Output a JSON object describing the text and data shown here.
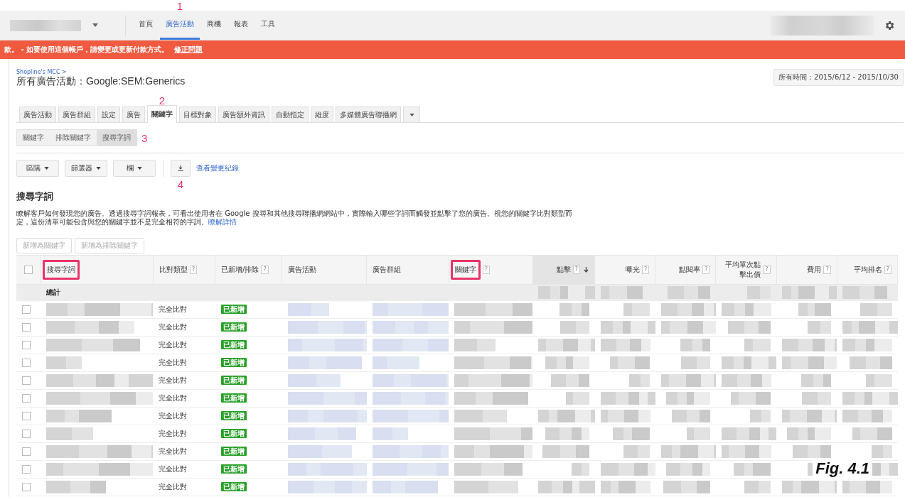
{
  "nav": {
    "items": [
      {
        "label": "首頁",
        "selected": false
      },
      {
        "label": "廣告活動",
        "selected": true,
        "marker": "1"
      },
      {
        "label": "商機",
        "selected": false
      },
      {
        "label": "報表",
        "selected": false
      },
      {
        "label": "工具",
        "selected": false
      }
    ]
  },
  "alert": {
    "message": "款。 - 如要使用這個帳戶，請變更或更新付款方式。",
    "link": "修正問題"
  },
  "breadcrumb": "Shopline's MCC >",
  "title": "所有廣告活動：Google:SEM:Generics",
  "date_range": "所有時間：2015/6/12 - 2015/10/30",
  "tabs": [
    {
      "label": "廣告活動",
      "selected": false
    },
    {
      "label": "廣告群組",
      "selected": false
    },
    {
      "label": "設定",
      "selected": false
    },
    {
      "label": "廣告",
      "selected": false
    },
    {
      "label": "關鍵字",
      "selected": true,
      "marker": "2"
    },
    {
      "label": "目標對象",
      "selected": false
    },
    {
      "label": "廣告額外資訊",
      "selected": false
    },
    {
      "label": "自動指定",
      "selected": false
    },
    {
      "label": "維度",
      "selected": false
    },
    {
      "label": "多媒體廣告聯播網",
      "selected": false
    }
  ],
  "subtabs": [
    {
      "label": "關鍵字",
      "selected": false
    },
    {
      "label": "排除關鍵字",
      "selected": false
    },
    {
      "label": "搜尋字詞",
      "selected": true,
      "marker": "3"
    }
  ],
  "toolbar": {
    "dropdowns": [
      "區隔",
      "篩選器",
      "欄"
    ],
    "download_marker": "4",
    "link": "查看變更紀錄"
  },
  "heading": "搜尋字詞",
  "description": "瞭解客戶如何發現您的廣告。透過搜尋字詞報表，可看出使用者在 Google 搜尋和其他搜尋聯播網網站中，實際輸入哪些字詞而觸發並點擊了您的廣告。視您的關鍵字比對類型而定，這份清單可能包含與您的關鍵字並不是完全相符的字詞。",
  "description_link": "瞭解詳情",
  "actions": [
    {
      "label": "新增為關鍵字",
      "disabled": true
    },
    {
      "label": "新增為排除關鍵字",
      "disabled": true
    }
  ],
  "table": {
    "select_all_checked": false,
    "columns": [
      {
        "label": "搜尋字詞",
        "kind": "text",
        "highlighted": true,
        "sorted": false
      },
      {
        "label": "比對類型",
        "kind": "text",
        "help": "?",
        "highlighted": false,
        "sorted": false
      },
      {
        "label": "已新增/排除",
        "kind": "text",
        "help": "?",
        "highlighted": false,
        "sorted": false
      },
      {
        "label": "廣告活動",
        "kind": "text",
        "highlighted": false,
        "sorted": false
      },
      {
        "label": "廣告群組",
        "kind": "text",
        "highlighted": false,
        "sorted": false
      },
      {
        "label": "關鍵字",
        "kind": "text",
        "help": "?",
        "highlighted": true,
        "sorted": false
      },
      {
        "label": "點擊",
        "kind": "metric",
        "help": "?",
        "highlighted": false,
        "sorted": true
      },
      {
        "label": "曝光",
        "kind": "metric",
        "help": "?",
        "highlighted": false,
        "sorted": false
      },
      {
        "label": "點閱率",
        "kind": "metric",
        "help": "?",
        "highlighted": false,
        "sorted": false
      },
      {
        "label": "平均單次點擊出價",
        "kind": "metric",
        "help": "?",
        "highlighted": false,
        "sorted": false
      },
      {
        "label": "費用",
        "kind": "metric",
        "help": "?",
        "highlighted": false,
        "sorted": false
      },
      {
        "label": "平均排名",
        "kind": "metric",
        "help": "?",
        "highlighted": false,
        "sorted": false
      }
    ],
    "total_label": "總計",
    "rows": [
      {
        "checked": false,
        "match_type": "完全比對",
        "status": "已新增"
      },
      {
        "checked": false,
        "match_type": "完全比對",
        "status": "已新增"
      },
      {
        "checked": false,
        "match_type": "完全比對",
        "status": "已新增"
      },
      {
        "checked": false,
        "match_type": "完全比對",
        "status": "已新增"
      },
      {
        "checked": false,
        "match_type": "完全比對",
        "status": "已新增"
      },
      {
        "checked": false,
        "match_type": "完全比對",
        "status": "已新增"
      },
      {
        "checked": false,
        "match_type": "完全比對",
        "status": "已新增"
      },
      {
        "checked": false,
        "match_type": "完全比對",
        "status": "已新增"
      },
      {
        "checked": false,
        "match_type": "完全比對",
        "status": "已新增"
      },
      {
        "checked": false,
        "match_type": "完全比對",
        "status": "已新增"
      },
      {
        "checked": false,
        "match_type": "完全比對",
        "status": "已新增"
      }
    ]
  },
  "caption": "Fig. 4.1"
}
